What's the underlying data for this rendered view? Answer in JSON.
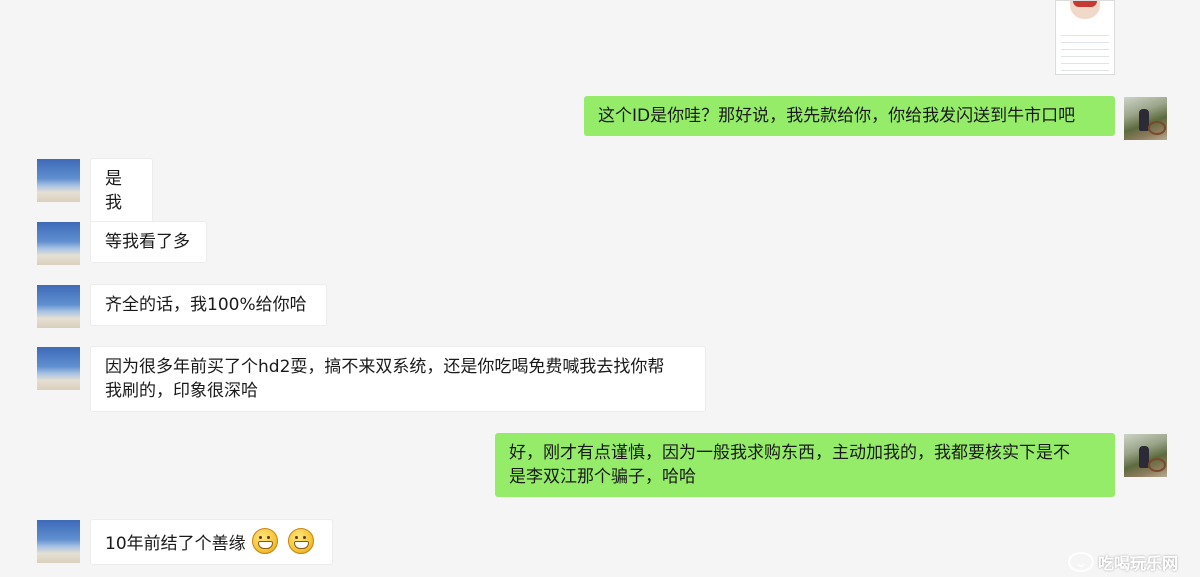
{
  "colors": {
    "background": "#f5f5f5",
    "outgoing_bubble": "#95ec69",
    "incoming_bubble": "#ffffff"
  },
  "shared_image": {
    "icon": "profile-card-thumbnail"
  },
  "messages": [
    {
      "sender": "me",
      "text": "这个ID是你哇？那好说，我先款给你，你给我发闪送到牛市口吧"
    },
    {
      "sender": "friend",
      "text": "是我"
    },
    {
      "sender": "friend",
      "text": "等我看了多"
    },
    {
      "sender": "friend",
      "text": "齐全的话，我100%给你哈"
    },
    {
      "sender": "friend",
      "text_line1": "因为很多年前买了个hd2耍，搞不来双系统，还是你吃喝免费喊我去找你帮",
      "text_line2": "我刷的，印象很深哈"
    },
    {
      "sender": "me",
      "text_line1": "好，刚才有点谨慎，因为一般我求购东西，主动加我的，我都要核实下是不",
      "text_line2": "是李双江那个骗子，哈哈"
    },
    {
      "sender": "friend",
      "text": "10年前结了个善缘",
      "emojis": [
        "grin-emoji",
        "grin-emoji"
      ]
    }
  ],
  "watermark": {
    "text": "吃喝玩乐网"
  }
}
